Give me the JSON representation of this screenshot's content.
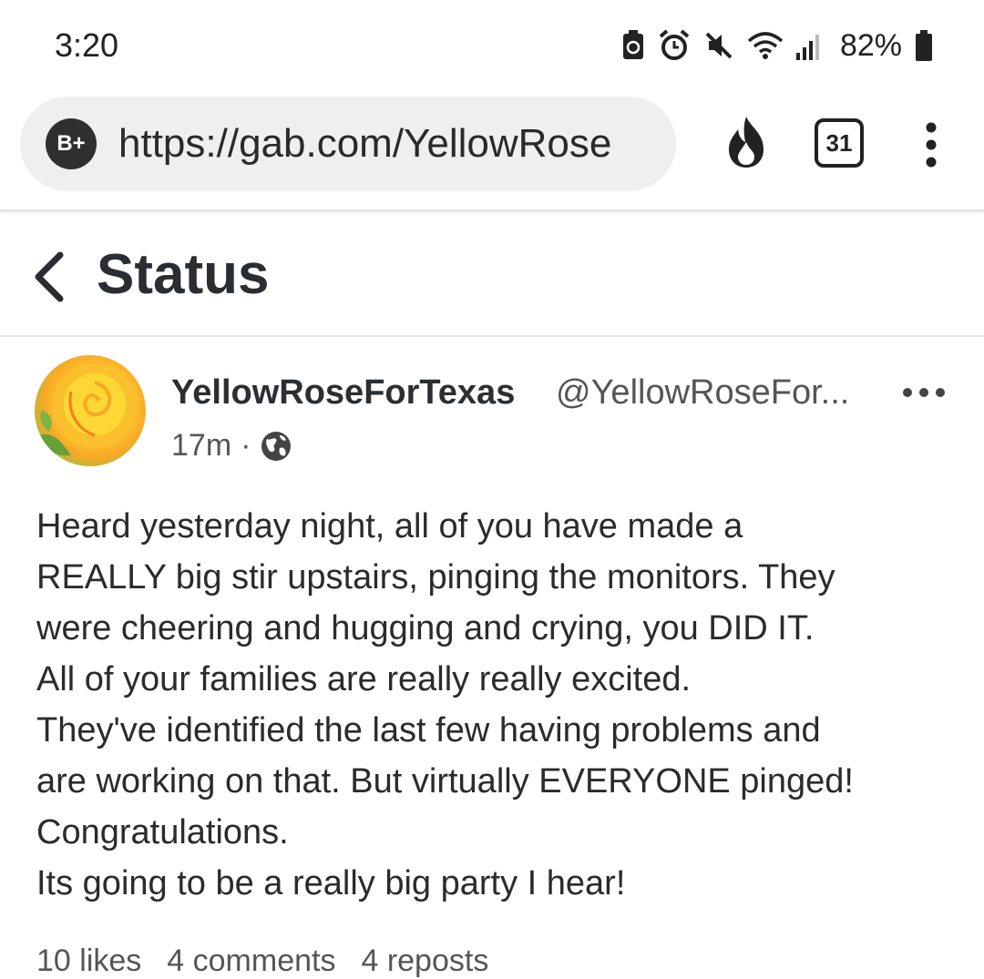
{
  "status_bar": {
    "time": "3:20",
    "battery_percent": "82%",
    "icons": [
      "recycle-battery-icon",
      "alarm-icon",
      "mute-icon",
      "wifi-icon",
      "signal-icon",
      "battery-icon"
    ]
  },
  "browser": {
    "badge": "B+",
    "url": "https://gab.com/YellowRose",
    "tab_count": "31",
    "icons": [
      "fire-icon",
      "tabs-icon",
      "more-vert-icon"
    ]
  },
  "header": {
    "title": "Status"
  },
  "post": {
    "display_name": "YellowRoseForTexas",
    "handle": "@YellowRoseFor...",
    "time_ago": "17m",
    "separator": "·",
    "body_lines": [
      "Heard yesterday night, all of you have made a",
      "REALLY big stir upstairs, pinging the monitors. They",
      "were cheering and hugging and crying, you DID IT.",
      "All of your families are really really excited.",
      "They've identified the last few having problems and",
      "are working on that. But virtually EVERYONE pinged!",
      "Congratulations.",
      "Its going to be a really big party I hear!"
    ],
    "stats": {
      "likes": "10 likes",
      "comments": "4 comments",
      "reposts": "4 reposts"
    }
  },
  "colors": {
    "text": "#2b2b2b",
    "url_pill": "#efefef",
    "muted": "#555555"
  }
}
